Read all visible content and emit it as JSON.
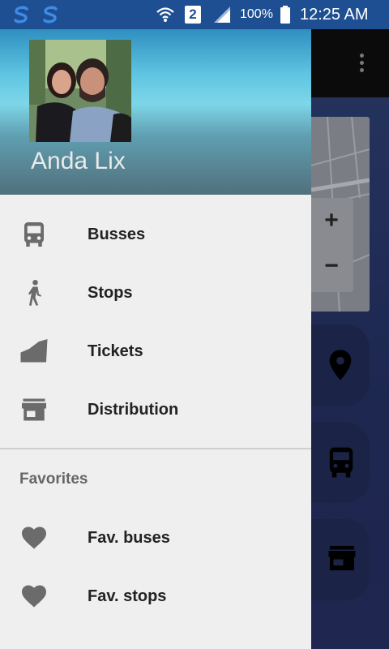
{
  "status_bar": {
    "network_badge": "2",
    "battery_percent": "100%",
    "time": "12:25 AM",
    "icons": [
      "app-notification-icon",
      "app-notification-icon",
      "wifi-icon",
      "signal-icon",
      "battery-icon"
    ]
  },
  "background_app": {
    "toolbar_icon": "overflow-menu-icon",
    "map_controls": {
      "zoom_in": "+",
      "zoom_out": "−"
    },
    "fab_icons": [
      "location-pin-icon",
      "bus-icon",
      "store-icon"
    ]
  },
  "drawer": {
    "user": {
      "name": "Anda Lix"
    },
    "menu": [
      {
        "label": "Busses",
        "icon": "bus-icon"
      },
      {
        "label": "Stops",
        "icon": "walk-icon"
      },
      {
        "label": "Tickets",
        "icon": "ticket-icon"
      },
      {
        "label": "Distribution",
        "icon": "store-icon"
      }
    ],
    "favorites_title": "Favorites",
    "favorites": [
      {
        "label": "Fav. buses",
        "icon": "heart-icon"
      },
      {
        "label": "Fav. stops",
        "icon": "heart-icon"
      }
    ]
  },
  "colors": {
    "status_bar": "#1f4f93",
    "drawer_bg": "#efefef",
    "icon_gray": "#6b6b6b",
    "background_app": "#1d2750"
  }
}
